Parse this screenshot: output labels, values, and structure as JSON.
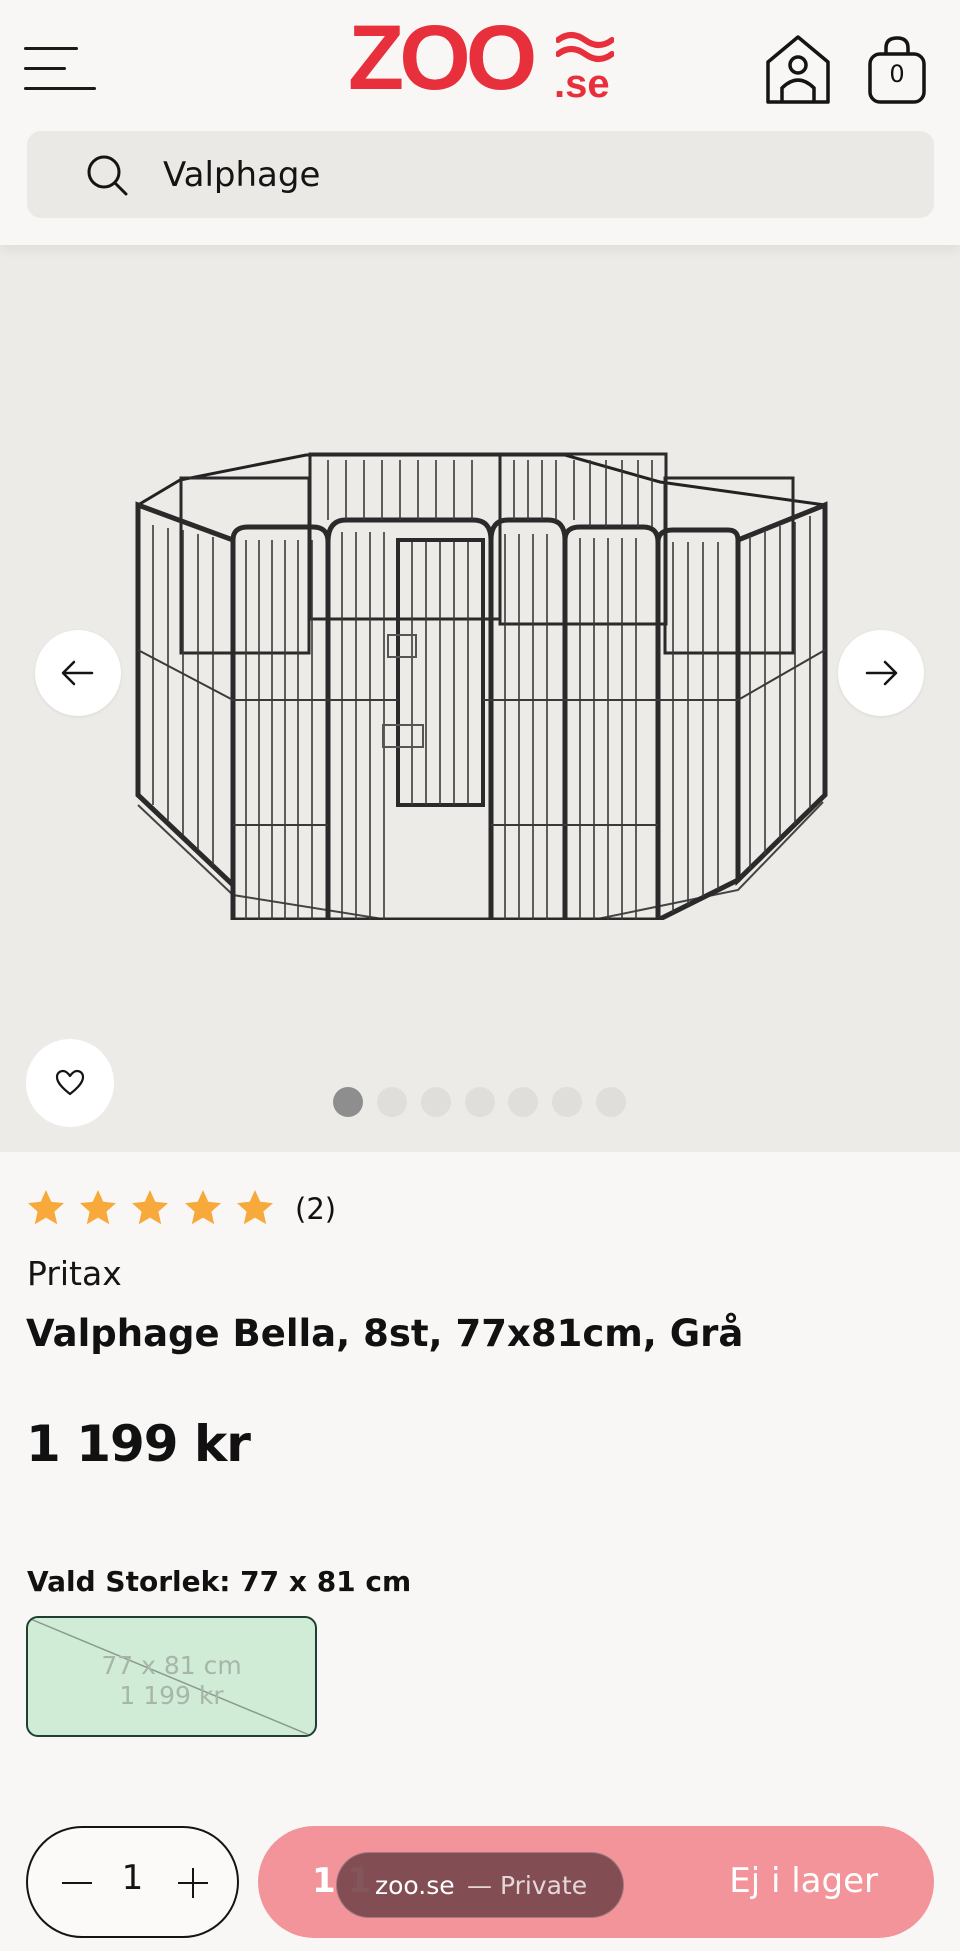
{
  "header": {
    "logo_main": "ZOO",
    "logo_suffix": ".se",
    "cart_count": "0",
    "search": {
      "value": "Valphage"
    }
  },
  "gallery": {
    "image_count": 7,
    "active_index": 0
  },
  "product": {
    "rating": {
      "stars": 5,
      "count_label": "(2)"
    },
    "brand": "Pritax",
    "title": "Valphage Bella, 8st, 77x81cm, Grå",
    "price": "1 199 kr",
    "size_label": "Vald Storlek: 77 x 81 cm",
    "size_options": [
      {
        "size": "77 x 81 cm",
        "price": "1 199 kr",
        "available": false
      }
    ]
  },
  "purchase": {
    "quantity": "1",
    "price_fragment": "1 1",
    "status": "Ej i lager"
  },
  "browser_pill": {
    "host": "zoo.se",
    "mode": "— Private"
  },
  "colors": {
    "brand_red": "#e8303c",
    "buy_button": "#f29499",
    "size_option_bg": "#d0ecd6",
    "star": "#f7a93b"
  }
}
